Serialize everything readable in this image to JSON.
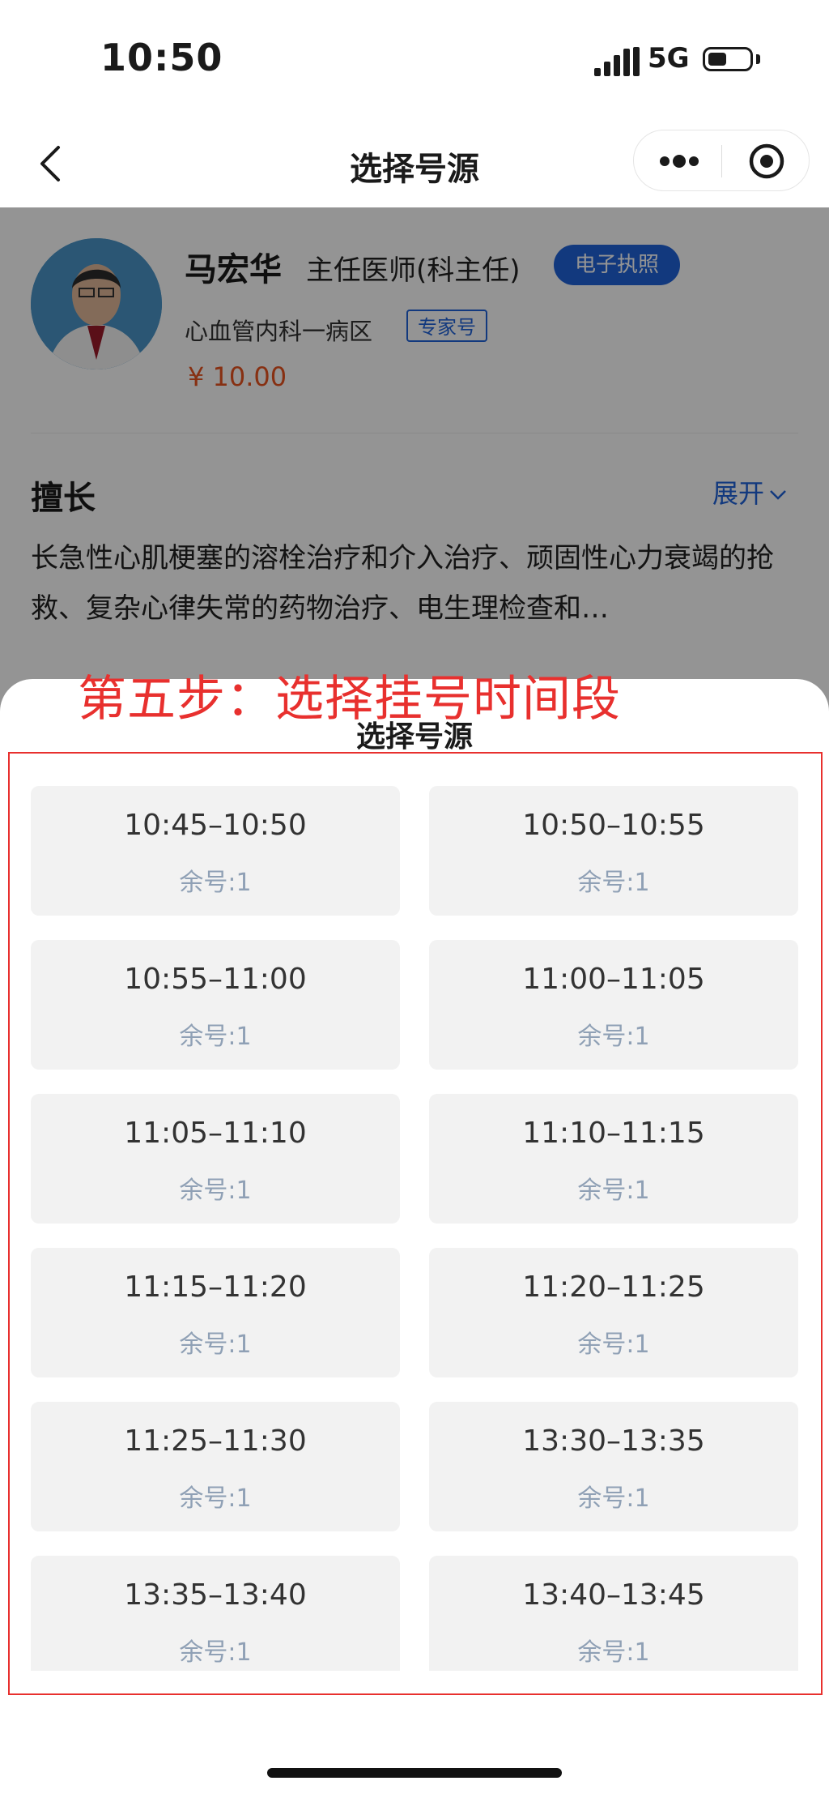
{
  "status_bar": {
    "time": "10:50",
    "network": "5G"
  },
  "nav": {
    "title": "选择号源"
  },
  "doctor": {
    "name": "马宏华",
    "title": "主任医师(科主任)",
    "license_badge": "电子执照",
    "department": "心血管内科一病区",
    "type_badge": "专家号",
    "price": "¥ 10.00"
  },
  "specialty": {
    "title": "擅长",
    "expand_label": "展开",
    "text": "长急性心肌梗塞的溶栓治疗和介入治疗、顽固性心力衰竭的抢救、复杂心律失常的药物治疗、电生理检查和…"
  },
  "annotation": "第五步：选择挂号时间段",
  "sheet": {
    "title": "选择号源",
    "slots": [
      {
        "time": "10:45–10:50",
        "remain": "余号:1"
      },
      {
        "time": "10:50–10:55",
        "remain": "余号:1"
      },
      {
        "time": "10:55–11:00",
        "remain": "余号:1"
      },
      {
        "time": "11:00–11:05",
        "remain": "余号:1"
      },
      {
        "time": "11:05–11:10",
        "remain": "余号:1"
      },
      {
        "time": "11:10–11:15",
        "remain": "余号:1"
      },
      {
        "time": "11:15–11:20",
        "remain": "余号:1"
      },
      {
        "time": "11:20–11:25",
        "remain": "余号:1"
      },
      {
        "time": "11:25–11:30",
        "remain": "余号:1"
      },
      {
        "time": "13:30–13:35",
        "remain": "余号:1"
      },
      {
        "time": "13:35–13:40",
        "remain": "余号:1"
      },
      {
        "time": "13:40–13:45",
        "remain": "余号:1"
      }
    ]
  },
  "colors": {
    "accent_blue": "#1f62d9",
    "price_orange": "#e8531f",
    "annotation_red": "#e8302e",
    "slot_bg": "#f2f2f2",
    "slot_remain": "#8fa0b5"
  }
}
